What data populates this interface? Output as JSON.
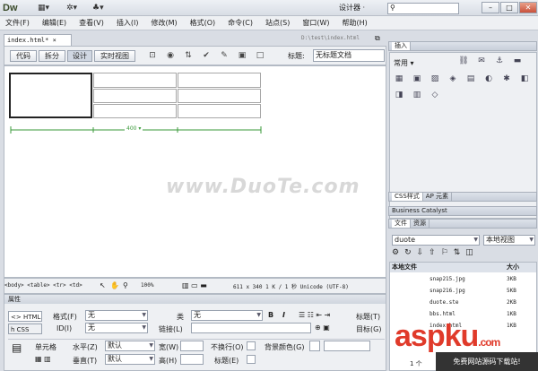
{
  "app": {
    "logo": "Dw",
    "workspace": "设计器 ·"
  },
  "menu": [
    "文件(F)",
    "编辑(E)",
    "查看(V)",
    "插入(I)",
    "修改(M)",
    "格式(O)",
    "命令(C)",
    "站点(S)",
    "窗口(W)",
    "帮助(H)"
  ],
  "document": {
    "tab": "index.html* ×",
    "path": "D:\\test\\index.html",
    "views": [
      "代码",
      "拆分",
      "设计",
      "实时视图"
    ],
    "title_label": "标题:",
    "title_value": "无标题文档",
    "table_width_label": "400 ▾"
  },
  "watermark": "www.DuoTe.com",
  "status": {
    "tags": "<body> <table> <tr> <td>",
    "zoom": "100%",
    "info": "611 x 340   1 K / 1 秒  Unicode (UTF-8)"
  },
  "props": {
    "title": "属性",
    "html_tab": "<> HTML",
    "css_tab": "h CSS",
    "format_label": "格式(F)",
    "format_value": "无",
    "class_label": "类",
    "class_value": "无",
    "id_label": "ID(I)",
    "id_value": "无",
    "link_label": "链接(L)",
    "bold": "B",
    "italic": "I",
    "heading_label": "标题(T)",
    "target_label": "目标(G)",
    "cell_label": "单元格",
    "halign_label": "水平(Z)",
    "halign_value": "默认",
    "valign_label": "垂直(T)",
    "valign_value": "默认",
    "width_label": "宽(W)",
    "height_label": "高(H)",
    "nowrap_label": "不换行(O)",
    "header_label": "标题(E)",
    "bgcolor_label": "背景颜色(G)"
  },
  "insert_panel": {
    "title": "插入",
    "category": "常用 ▾"
  },
  "panels": {
    "css_tabs": [
      "CSS样式",
      "AP 元素"
    ],
    "bc": "Business Catalyst",
    "files_tabs": [
      "文件",
      "资源"
    ],
    "site": "duote",
    "view": "本地视图",
    "col_name": "本地文件",
    "col_size": "大小",
    "files": [
      {
        "name": "snap215.jpg",
        "size": "3KB"
      },
      {
        "name": "snap216.jpg",
        "size": "5KB"
      },
      {
        "name": "duote.ste",
        "size": "2KB"
      },
      {
        "name": "bbs.html",
        "size": "1KB"
      },
      {
        "name": "index.html",
        "size": "1KB"
      }
    ],
    "status": "1 个"
  },
  "overlay": {
    "brand": "aspku",
    "brand_tld": ".com",
    "slogan": "免费网站源码下载站!"
  }
}
